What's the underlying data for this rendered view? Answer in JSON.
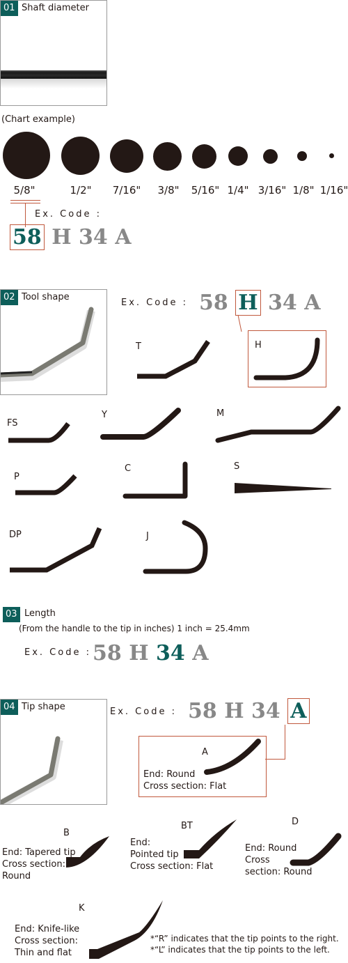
{
  "sections": {
    "s1": {
      "number": "01",
      "title": "Shaft diameter"
    },
    "s2": {
      "number": "02",
      "title": "Tool shape"
    },
    "s3": {
      "number": "03",
      "title": "Length",
      "note": "(From the handle to the tip in inches) 1 inch = 25.4mm"
    },
    "s4": {
      "number": "04",
      "title": "Tip shape"
    }
  },
  "chart_example_label": "(Chart example)",
  "diameters": [
    "5/8\"",
    "1/2\"",
    "7/16\"",
    "3/8\"",
    "5/16\"",
    "1/4\"",
    "3/16\"",
    "1/8\"",
    "1/16\""
  ],
  "example_code": {
    "label": "Ex. Code :",
    "parts": [
      "58",
      "H",
      "34",
      "A"
    ]
  },
  "tool_shapes": [
    "T",
    "H",
    "FS",
    "Y",
    "M",
    "P",
    "C",
    "S",
    "DP",
    "J"
  ],
  "tip_shapes": {
    "A": {
      "code": "A",
      "lines": [
        "End: Round",
        "Cross section: Flat"
      ]
    },
    "B": {
      "code": "B",
      "lines": [
        "End: Tapered tip",
        "Cross section:",
        "Round"
      ]
    },
    "BT": {
      "code": "BT",
      "lines": [
        "End:",
        "Pointed tip",
        "Cross section: Flat"
      ]
    },
    "D": {
      "code": "D",
      "lines": [
        "End: Round",
        "Cross",
        "section: Round"
      ]
    },
    "K": {
      "code": "K",
      "lines": [
        "End: Knife-like",
        "Cross section:",
        "Thin and flat"
      ]
    }
  },
  "notes": [
    "*“R” indicates that the tip points to the right.",
    "*“L” indicates that the tip points to the left."
  ],
  "colors": {
    "accent": "#0d5e5a",
    "highlight_border": "#c0583c",
    "code_gray": "#888888",
    "ink": "#231815"
  }
}
